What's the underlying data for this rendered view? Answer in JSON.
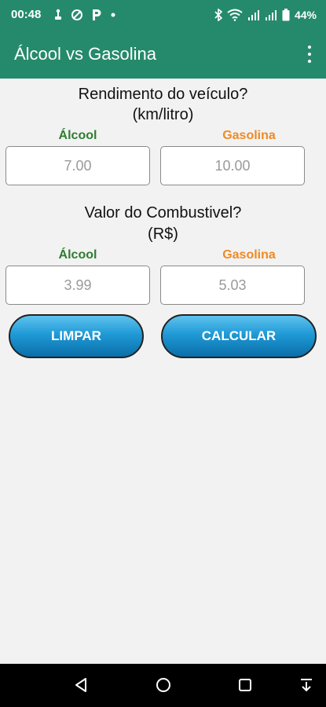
{
  "status": {
    "time": "00:48",
    "battery": "44%"
  },
  "app": {
    "title": "Álcool vs Gasolina"
  },
  "rendimento": {
    "title_line1": "Rendimento do veículo?",
    "title_line2": "(km/litro)",
    "alcool_label": "Álcool",
    "gasolina_label": "Gasolina",
    "alcool_placeholder": "7.00",
    "gasolina_placeholder": "10.00"
  },
  "valor": {
    "title_line1": "Valor do Combustivel?",
    "title_line2": "(R$)",
    "alcool_label": "Álcool",
    "gasolina_label": "Gasolina",
    "alcool_placeholder": "3.99",
    "gasolina_placeholder": "5.03"
  },
  "buttons": {
    "clear_label": "LIMPAR",
    "calculate_label": "CALCULAR"
  },
  "colors": {
    "appbar": "#258a6b",
    "alcool": "#2e7d32",
    "gasolina": "#f08a24",
    "button": "#1f9ad6"
  },
  "icons": {
    "status_left": [
      "usb-icon",
      "sync-off-icon",
      "parking-icon",
      "dot-icon"
    ],
    "status_right": [
      "bluetooth-icon",
      "wifi-icon",
      "signal-icon",
      "signal-icon",
      "battery-icon"
    ],
    "nav": [
      "back-icon",
      "home-icon",
      "recents-icon",
      "keyboard-hide-icon"
    ]
  }
}
